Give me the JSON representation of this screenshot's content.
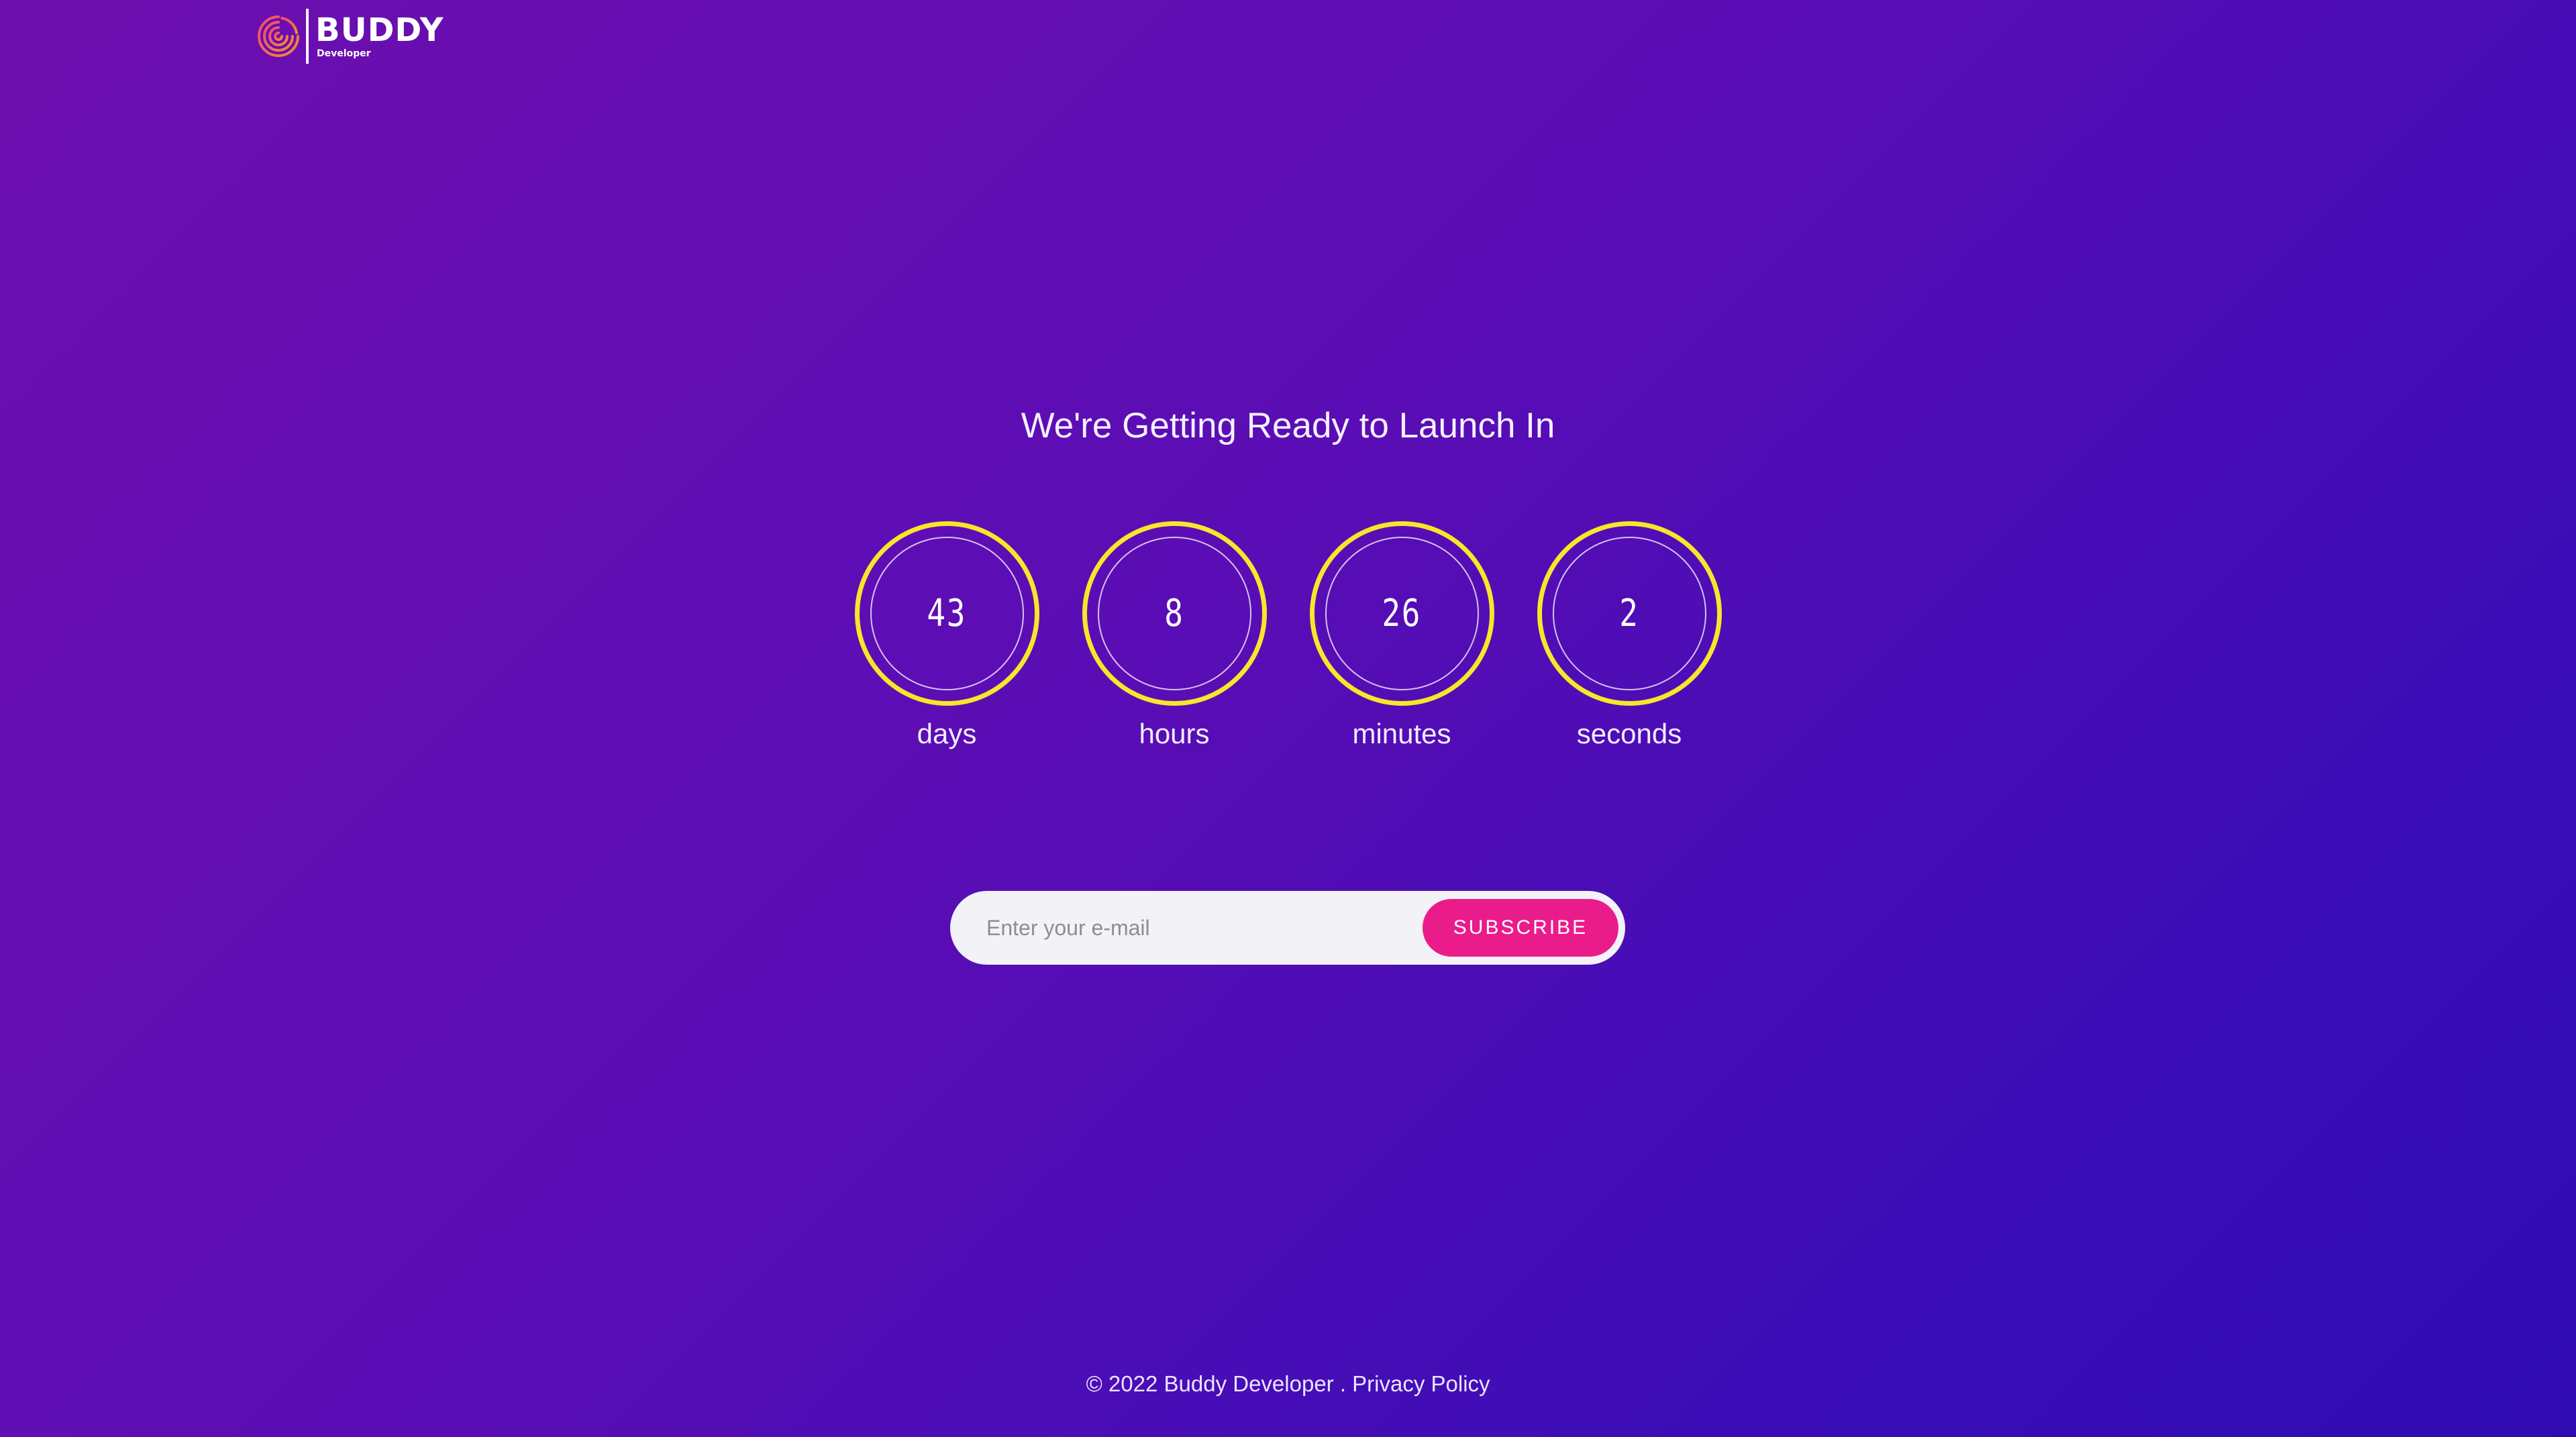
{
  "brand": {
    "name": "BUDDY",
    "tagline": "Developer",
    "logo_icon": "concentric-swirl-icon",
    "logo_colors": [
      "#f24a6c",
      "#f38a3c"
    ]
  },
  "headline": "We're Getting Ready to Launch In",
  "countdown": [
    {
      "value": "43",
      "label": "days"
    },
    {
      "value": "8",
      "label": "hours"
    },
    {
      "value": "26",
      "label": "minutes"
    },
    {
      "value": "2",
      "label": "seconds"
    }
  ],
  "subscribe": {
    "placeholder": "Enter your e-mail",
    "value": "",
    "button_label": "SUBSCRIBE"
  },
  "footer": {
    "copyright": "©  2022 Buddy Developer .",
    "privacy_link": "Privacy Policy"
  },
  "colors": {
    "background_start": "#6d0faf",
    "background_end": "#2f0cb2",
    "ring": "#f7e62a",
    "button": "#ea1c8c",
    "input_bg": "#f2f2f7"
  }
}
